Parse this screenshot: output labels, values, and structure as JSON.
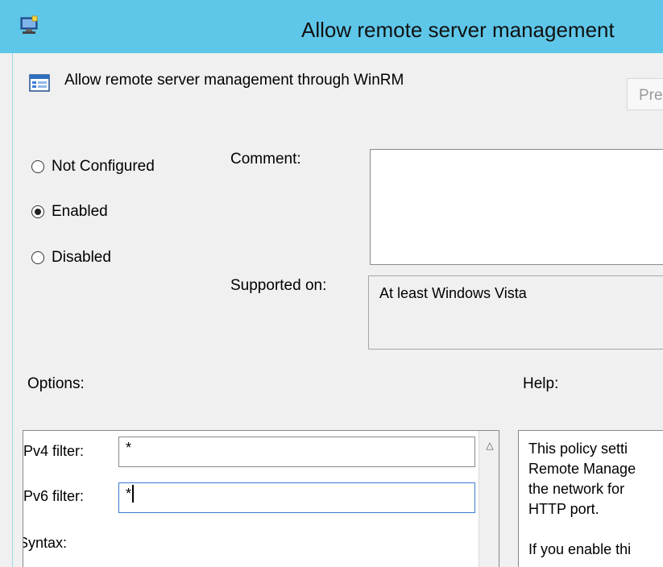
{
  "window": {
    "title": "Allow remote server management",
    "title_icon": "policy-window-icon"
  },
  "header": {
    "policy_name": "Allow remote server management through WinRM",
    "icon": "policy-setting-icon",
    "previous_button_label": "Pre"
  },
  "state": {
    "options": [
      {
        "label": "Not Configured",
        "selected": false
      },
      {
        "label": "Enabled",
        "selected": true
      },
      {
        "label": "Disabled",
        "selected": false
      }
    ]
  },
  "comment": {
    "label": "Comment:",
    "value": ""
  },
  "supported": {
    "label": "Supported on:",
    "value": "At least Windows Vista"
  },
  "options_section": {
    "label": "Options:",
    "ipv4_label": "Pv4 filter:",
    "ipv4_value": "*",
    "ipv6_label": "Pv6 filter:",
    "ipv6_value": "*",
    "syntax_label": "Syntax:"
  },
  "help_section": {
    "label": "Help:",
    "lines": [
      "This policy setti",
      "Remote Manage",
      "the network for",
      "HTTP port.",
      "",
      "If you enable thi"
    ]
  },
  "colors": {
    "titlebar": "#5ec7e9",
    "dialog_bg": "#f0f0f0",
    "focus_border": "#3c79d0"
  }
}
